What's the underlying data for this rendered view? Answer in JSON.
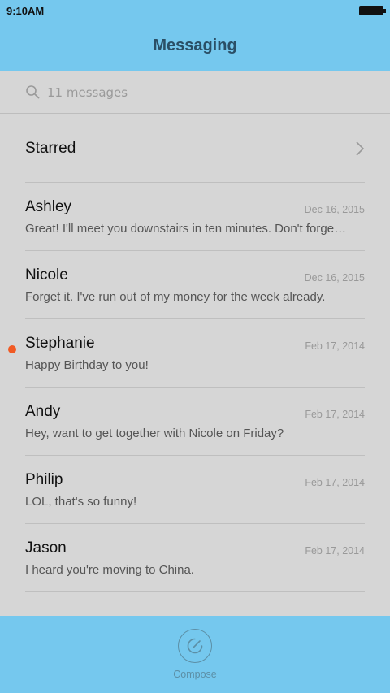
{
  "status": {
    "time": "9:10AM"
  },
  "header": {
    "title": "Messaging"
  },
  "search": {
    "placeholder": "11 messages"
  },
  "starred": {
    "label": "Starred"
  },
  "conversations": [
    {
      "name": "Ashley",
      "date": "Dec 16, 2015",
      "preview": "Great! I'll meet you downstairs in ten minutes. Don't forge…",
      "unread": false
    },
    {
      "name": "Nicole",
      "date": "Dec 16, 2015",
      "preview": "Forget it. I've run out of my money for the week already.",
      "unread": false
    },
    {
      "name": "Stephanie",
      "date": "Feb 17, 2014",
      "preview": "Happy Birthday to you!",
      "unread": true
    },
    {
      "name": "Andy",
      "date": "Feb 17, 2014",
      "preview": "Hey, want to get together with Nicole on Friday?",
      "unread": false
    },
    {
      "name": "Philip",
      "date": "Feb 17, 2014",
      "preview": "LOL, that's so funny!",
      "unread": false
    },
    {
      "name": "Jason",
      "date": "Feb 17, 2014",
      "preview": "I heard you're moving to China.",
      "unread": false
    }
  ],
  "compose": {
    "label": "Compose"
  },
  "colors": {
    "bar_blue": "#75c8ee",
    "background": "#d6d6d6",
    "unread_dot": "#f15a24",
    "title_text": "#2a4f66"
  }
}
